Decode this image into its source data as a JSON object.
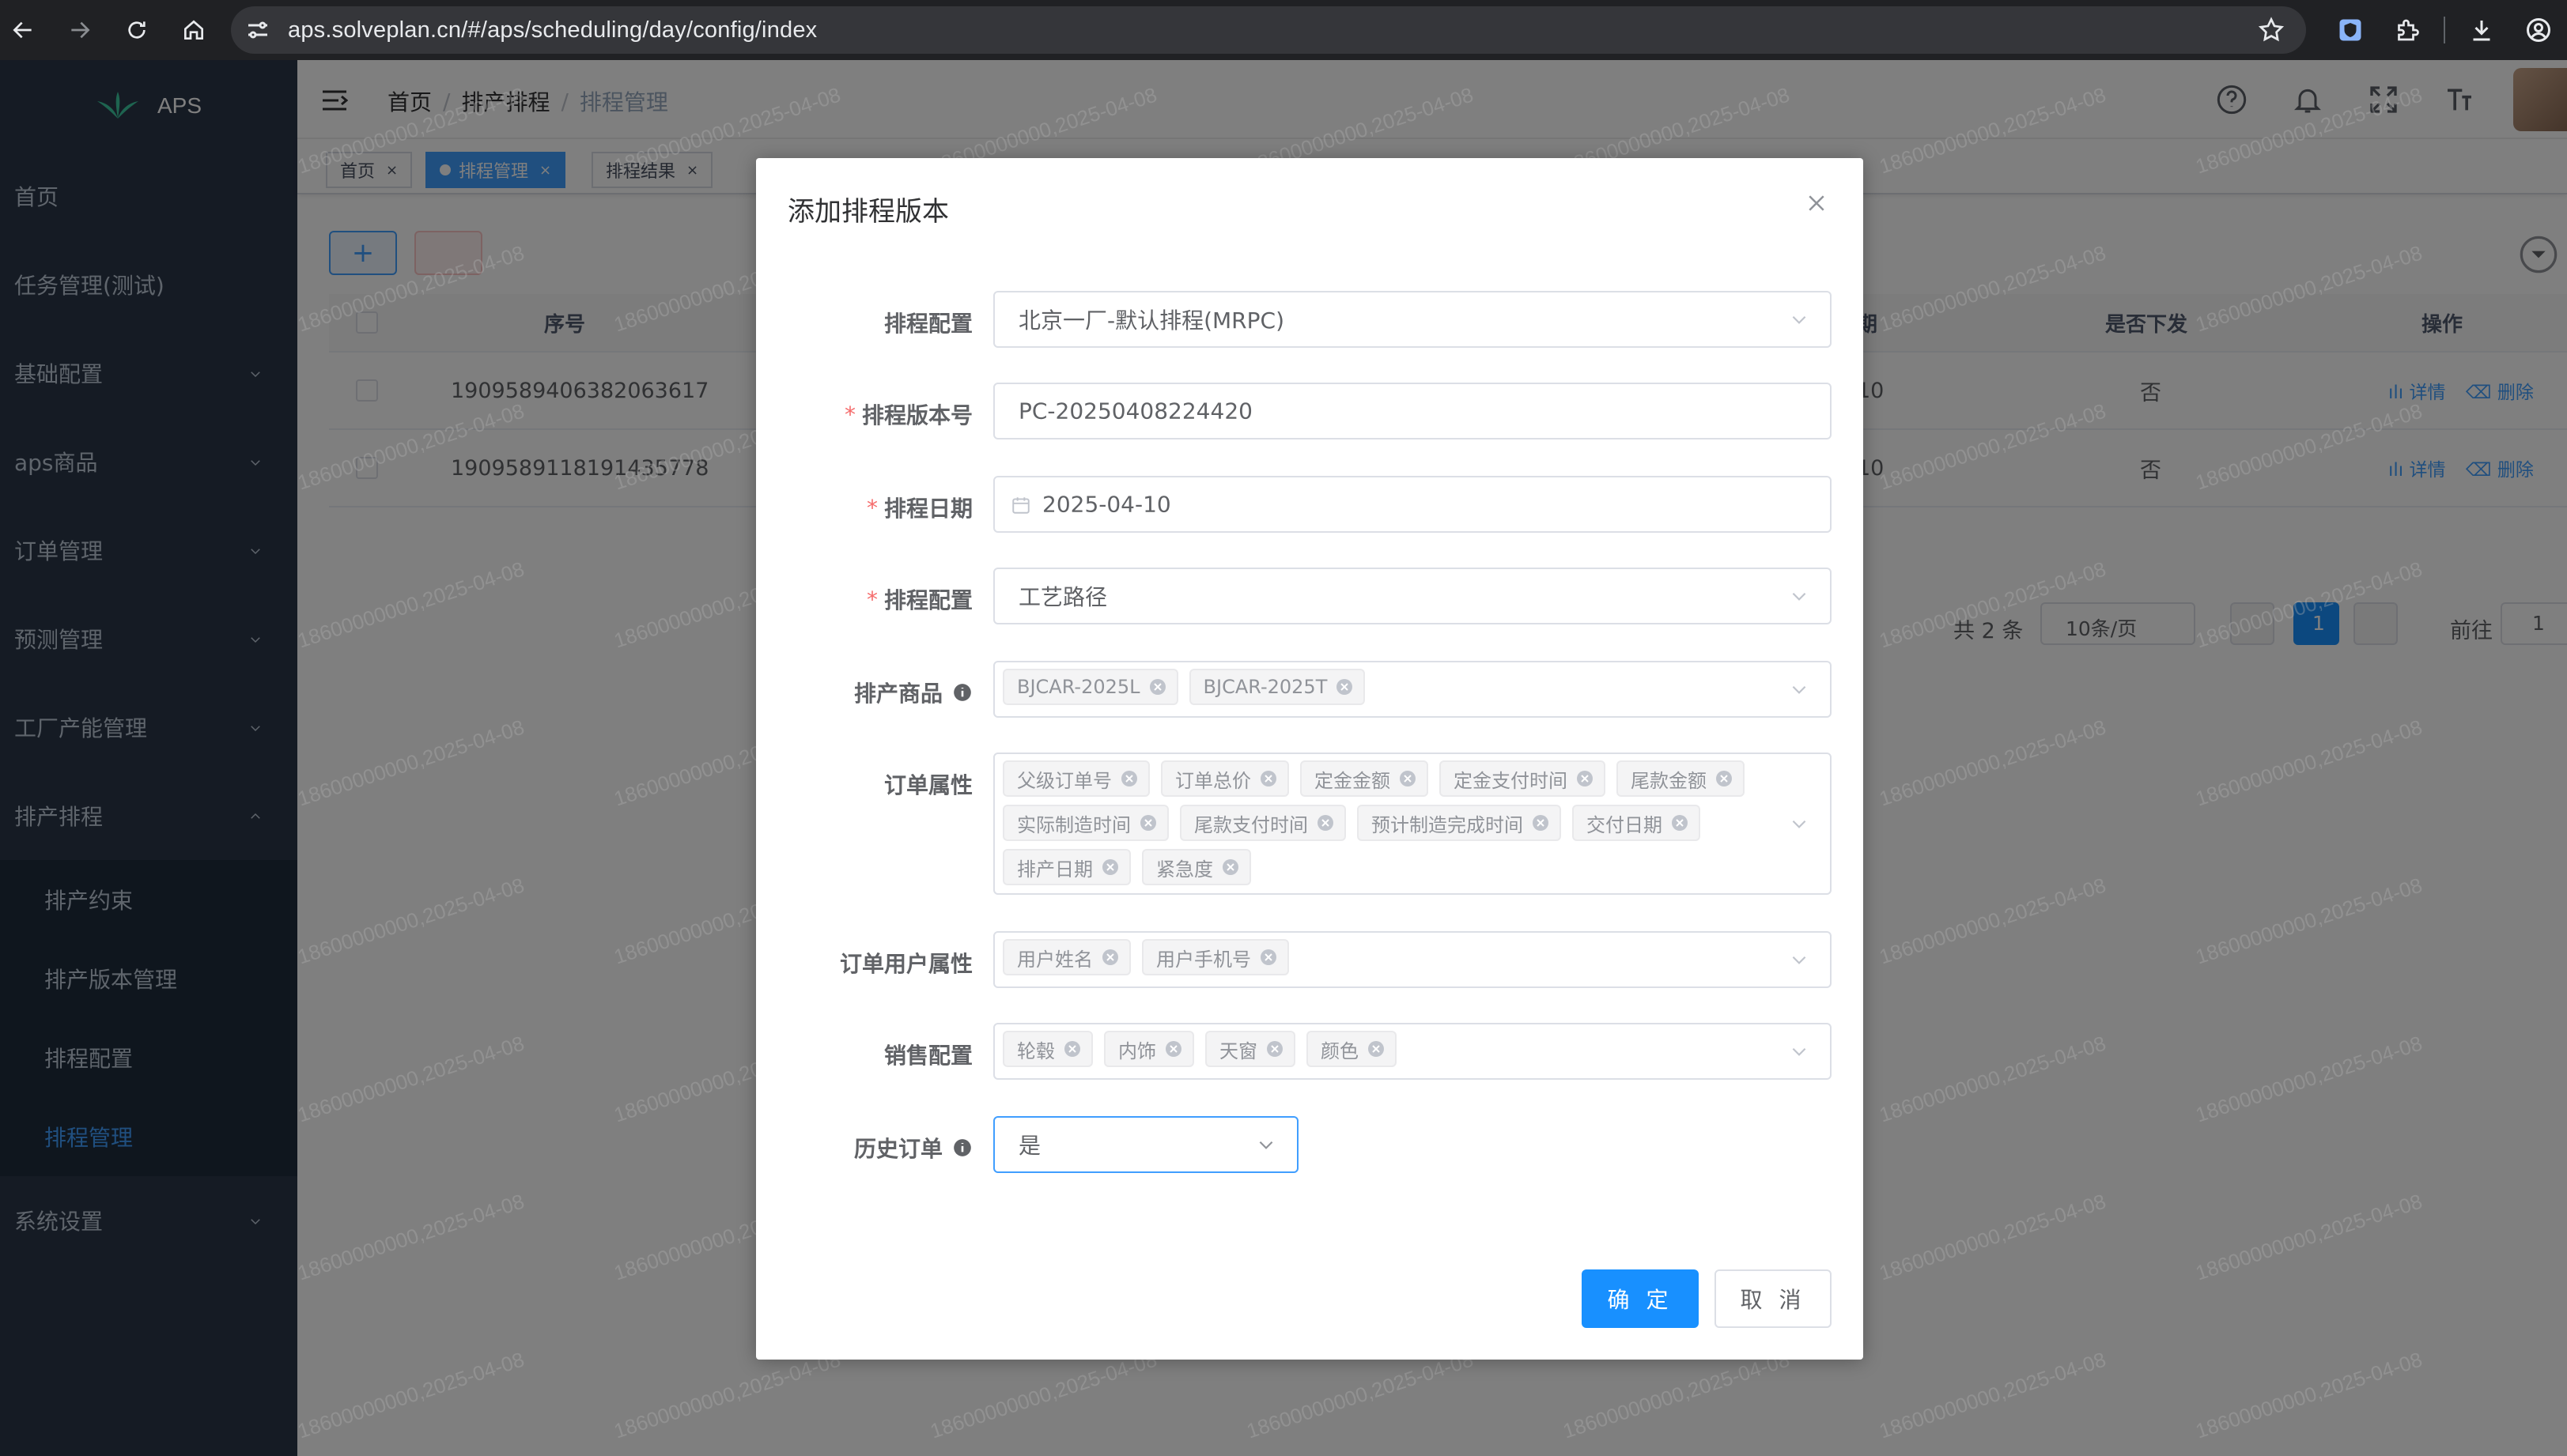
{
  "browser": {
    "url": "aps.solveplan.cn/#/aps/scheduling/day/config/index"
  },
  "sidebar": {
    "logo_text": "APS",
    "items": [
      {
        "label": "首页"
      },
      {
        "label": "任务管理(测试)"
      },
      {
        "label": "基础配置"
      },
      {
        "label": "aps商品"
      },
      {
        "label": "订单管理"
      },
      {
        "label": "预测管理"
      },
      {
        "label": "工厂产能管理"
      },
      {
        "label": "排产排程"
      }
    ],
    "subitems": [
      {
        "label": "排产约束"
      },
      {
        "label": "排产版本管理"
      },
      {
        "label": "排程配置"
      },
      {
        "label": "排程管理"
      }
    ],
    "last_item": "系统设置"
  },
  "breadcrumb": {
    "home": "首页",
    "middle": "排产排程",
    "current": "排程管理"
  },
  "tags": [
    {
      "label": "首页"
    },
    {
      "label": "排程管理"
    },
    {
      "label": "排程结果"
    }
  ],
  "table": {
    "col_seq": "序号",
    "col_date_suffix": "期",
    "col_issued": "是否下发",
    "col_ops": "操作",
    "rows": [
      {
        "seq": "1909589406382063617",
        "date_suffix": "10",
        "issued": "否",
        "detail": "详情",
        "delete": "删除"
      },
      {
        "seq": "1909589118191435778",
        "date_suffix": "10",
        "issued": "否",
        "detail": "详情",
        "delete": "删除"
      }
    ]
  },
  "pagination": {
    "total": "共 2 条",
    "page_size": "10条/页",
    "current_page": "1",
    "goto_label": "前往",
    "goto_value": "1"
  },
  "watermark_text": "18600000000,2025-04-08",
  "dialog": {
    "title": "添加排程版本",
    "fields": {
      "config": {
        "label": "排程配置",
        "value": "北京一厂-默认排程(MRPC)"
      },
      "version": {
        "label": "排程版本号",
        "value": "PC-20250408224420"
      },
      "date": {
        "label": "排程日期",
        "value": "2025-04-10"
      },
      "config2": {
        "label": "排程配置",
        "value": "工艺路径"
      },
      "products": {
        "label": "排产商品",
        "tags": [
          "BJCAR-2025L",
          "BJCAR-2025T"
        ]
      },
      "order_attrs": {
        "label": "订单属性",
        "tags": [
          "父级订单号",
          "订单总价",
          "定金金额",
          "定金支付时间",
          "尾款金额",
          "实际制造时间",
          "尾款支付时间",
          "预计制造完成时间",
          "交付日期",
          "排产日期",
          "紧急度"
        ]
      },
      "user_attrs": {
        "label": "订单用户属性",
        "tags": [
          "用户姓名",
          "用户手机号"
        ]
      },
      "sales": {
        "label": "销售配置",
        "tags": [
          "轮毂",
          "内饰",
          "天窗",
          "颜色"
        ]
      },
      "history": {
        "label": "历史订单",
        "value": "是"
      }
    },
    "confirm": "确 定",
    "cancel": "取 消"
  }
}
